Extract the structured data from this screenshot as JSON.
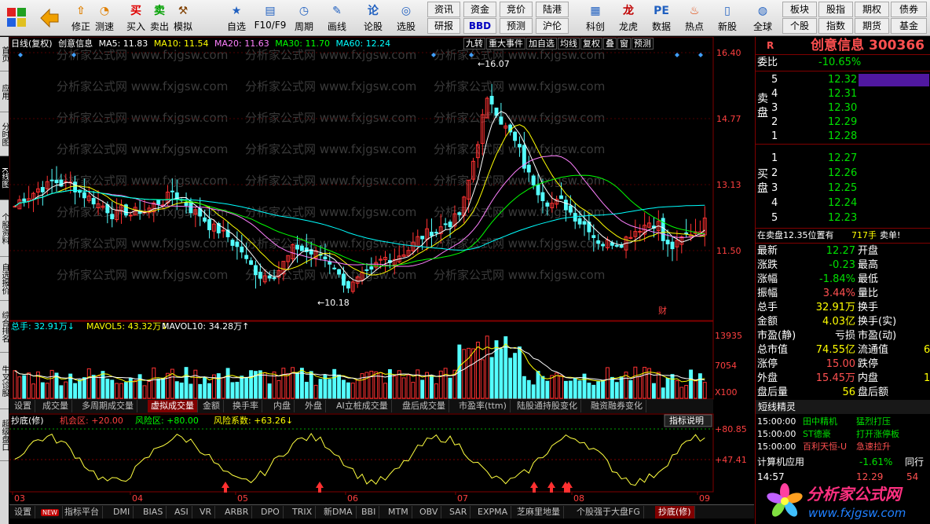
{
  "toolbar": {
    "buttons": [
      "修正",
      "测速",
      "买入",
      "卖出",
      "模拟",
      "自选",
      "F10/F9",
      "周期",
      "画线",
      "论股",
      "选股",
      "科创",
      "龙虎",
      "数据",
      "热点",
      "新股",
      "全球",
      "个股"
    ],
    "grid": [
      [
        "资讯",
        "资金",
        "竞价",
        "陆港"
      ],
      [
        "研报",
        "BBD",
        "预测",
        "沪伦"
      ]
    ],
    "right_grid": [
      [
        "板块",
        "股指",
        "期权",
        "债券"
      ],
      [
        "个股",
        "指数",
        "期货",
        "基金"
      ]
    ]
  },
  "left_tabs": [
    "首页",
    "应用",
    "分时图",
    "K线图",
    "个股资料",
    "自选报价",
    "综合排名",
    "牛叉诊股",
    "超级盘口"
  ],
  "chart": {
    "legend": {
      "period": "日线(复权)",
      "name": "创意信息",
      "ma5": "MA5: 11.83",
      "ma10": "MA10: 11.54",
      "ma20": "MA20: 11.63",
      "ma30": "MA30: 11.70",
      "ma60": "MA60: 12.24"
    },
    "controls": [
      "九转",
      "重大事件",
      "加自选",
      "均线",
      "复权",
      "叠",
      "窗",
      "预测"
    ],
    "price_axis": [
      "16.40",
      "14.77",
      "13.13",
      "11.50"
    ],
    "high_label": "16.07",
    "low_label": "10.18",
    "fin_mark": "财",
    "vol_legend": {
      "total": "总手: 32.91万",
      "mavol5": "MAVOL5: 43.32万",
      "mavol10": "MAVOL10: 34.28万"
    },
    "vol_axis": [
      "13935",
      "7054",
      "X100"
    ],
    "indicator_tabs": [
      "设置",
      "成交量",
      "多周期成交量",
      "虚拟成交量",
      "金额",
      "换手率",
      "内盘",
      "外盘",
      "AI立桩成交量",
      "盘后成交量",
      "市盈率(ttm)",
      "陆股通持股变化",
      "融资融券变化"
    ],
    "active_indicator_tab": "虚拟成交量",
    "ind_legend": {
      "name": "抄底(修)",
      "jh": "机会区: +20.00",
      "fx": "风险区: +80.00",
      "xs": "风险系数: +63.26"
    },
    "ind_help": "指标说明",
    "ind_axis": [
      "+80.85",
      "+47.41"
    ],
    "months": [
      "03",
      "04",
      "05",
      "06",
      "07",
      "08",
      "09"
    ],
    "bottom_tabs": [
      "设置",
      "NEW",
      "指标平台",
      "DMI",
      "BIAS",
      "ASI",
      "VR",
      "ARBR",
      "DPO",
      "TRIX",
      "新DMA",
      "BBI",
      "MTM",
      "OBV",
      "SAR",
      "EXPMA",
      "芝麻里地量",
      "个股强于大盘FG",
      "抄底(修)"
    ],
    "active_bottom_tab": "抄底(修)"
  },
  "watermark": "分析家公式网 www.fxjgsw.com",
  "stock": {
    "r": "R",
    "title": "创意信息 300366",
    "webi_label": "委比",
    "webi": "-10.65%",
    "sell_label": "卖盘",
    "buy_label": "买盘",
    "asks": [
      [
        "5",
        "12.32"
      ],
      [
        "4",
        "12.31"
      ],
      [
        "3",
        "12.30"
      ],
      [
        "2",
        "12.29"
      ],
      [
        "1",
        "12.28"
      ]
    ],
    "bids": [
      [
        "1",
        "12.27"
      ],
      [
        "2",
        "12.26"
      ],
      [
        "3",
        "12.25"
      ],
      [
        "4",
        "12.24"
      ],
      [
        "5",
        "12.23"
      ]
    ],
    "inside_note": "在卖盘12.35位置有",
    "inside_vol": "717手",
    "inside_tag": "卖单!",
    "quotes": [
      [
        "最新",
        "12.27",
        "开盘",
        ""
      ],
      [
        "涨跌",
        "-0.23",
        "最高",
        ""
      ],
      [
        "涨幅",
        "-1.84%",
        "最低",
        ""
      ],
      [
        "振幅",
        "3.44%",
        "量比",
        ""
      ],
      [
        "总手",
        "32.91万",
        "换手",
        ""
      ],
      [
        "金额",
        "4.03亿",
        "换手(实)",
        ""
      ],
      [
        "市盈(静)",
        "亏损",
        "市盈(动)",
        ""
      ],
      [
        "总市值",
        "74.55亿",
        "流通值",
        "6"
      ],
      [
        "涨停",
        "15.00",
        "跌停",
        ""
      ],
      [
        "外盘",
        "15.45万",
        "内盘",
        "1"
      ],
      [
        "盘后量",
        "56",
        "盘后额",
        ""
      ]
    ],
    "short_title": "短线精灵",
    "short_items": [
      [
        "15:00:00",
        "田中精机",
        "猛烈打压"
      ],
      [
        "15:00:00",
        "ST德豪",
        "打开涨停板"
      ],
      [
        "15:00:00",
        "百利天恒-U",
        "急速拉升"
      ]
    ],
    "calc_label": "计算机应用",
    "calc_val": "-1.61%",
    "calc_tab": "同行",
    "tick_time": "14:57",
    "tick_price": "12.29",
    "tick_vol": "54"
  },
  "logo": {
    "text": "分析家公式网",
    "url": "www.fxjgsw.com"
  },
  "colors": {
    "up": "#ff3232",
    "down": "#54ffff",
    "ma5": "#ffffff",
    "ma10": "#ffff00",
    "ma20": "#ff80ff",
    "ma30": "#00ff00",
    "ma60": "#00ffff"
  }
}
